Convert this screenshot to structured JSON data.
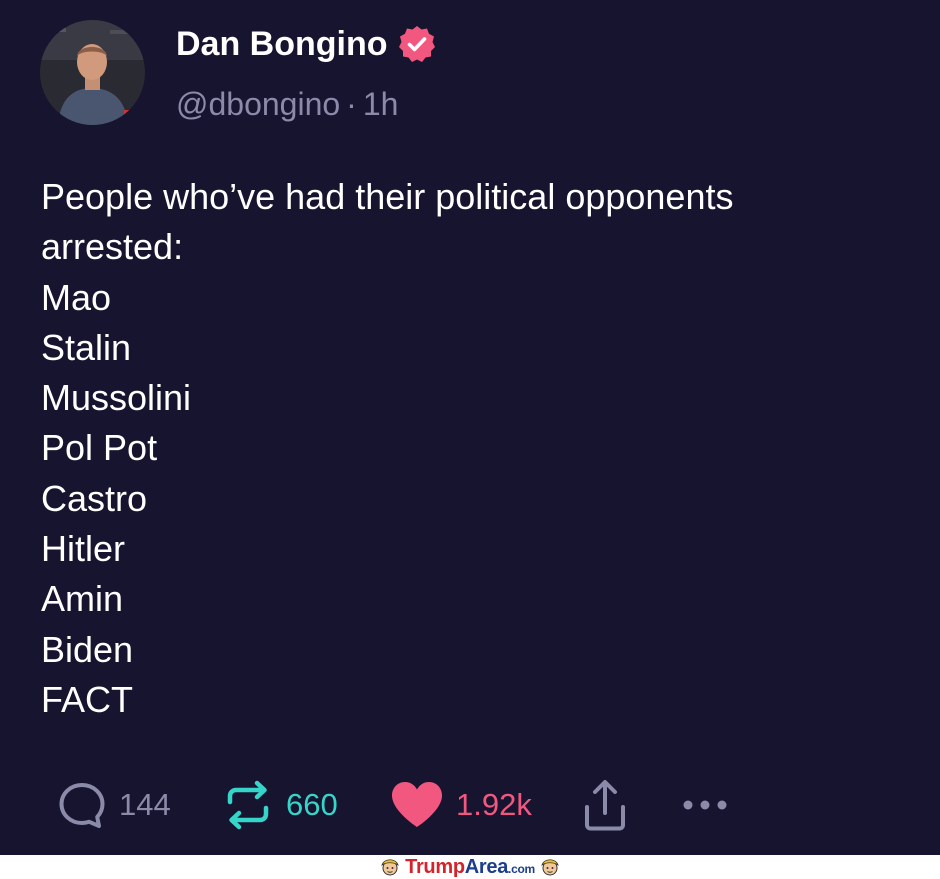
{
  "author": {
    "display_name": "Dan Bongino",
    "handle": "@dbongino",
    "separator": "·",
    "time": "1h",
    "verified_icon": "verified-badge-icon",
    "accent": "#f2587f"
  },
  "post": {
    "lines": [
      "People who’ve had their political opponents",
      "arrested:",
      "Mao",
      "Stalin",
      "Mussolini",
      "Pol Pot",
      "Castro",
      "Hitler",
      "Amin",
      "Biden",
      "FACT"
    ]
  },
  "actions": {
    "reply": {
      "icon": "comment-bubble-icon",
      "count": "144",
      "color": "#8b8aa8"
    },
    "repost": {
      "icon": "repost-arrows-icon",
      "count": "660",
      "color": "#35d5c9"
    },
    "like": {
      "icon": "heart-icon",
      "count": "1.92k",
      "color": "#f2587f"
    },
    "share": {
      "icon": "share-upload-icon"
    },
    "more": {
      "icon": "more-dots-icon"
    }
  },
  "footer": {
    "brand_part1": "Trump",
    "brand_part2": "Area",
    "brand_part3": ".com"
  }
}
